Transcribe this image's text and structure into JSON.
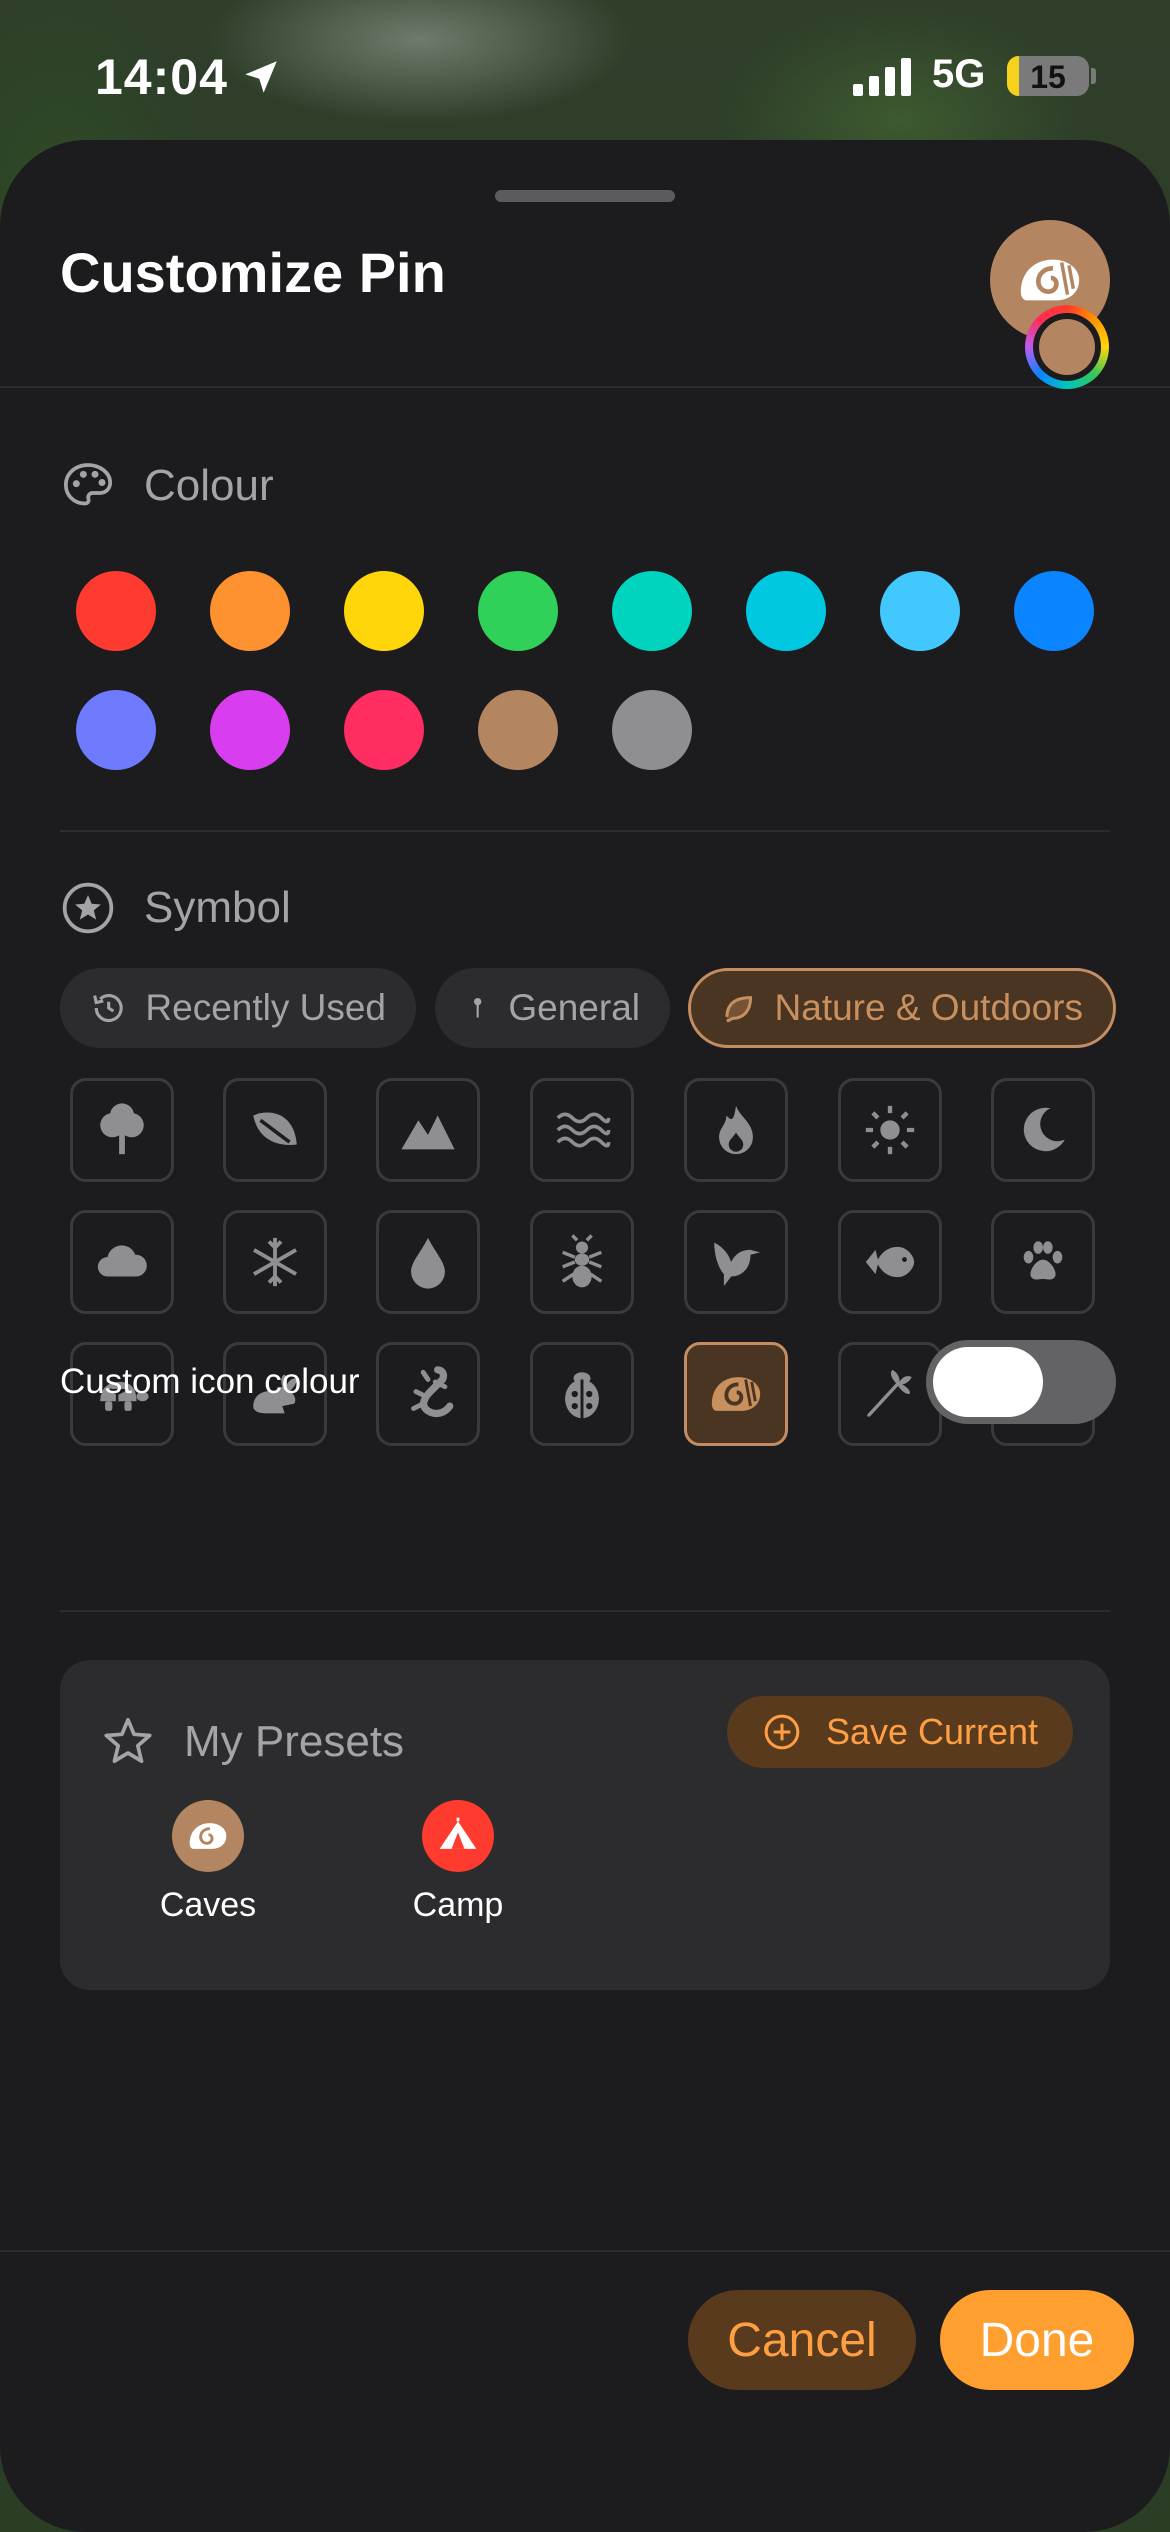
{
  "status_bar": {
    "time": "14:04",
    "network": "5G",
    "battery": "15",
    "battery_level_percent": 15,
    "icons": [
      "location-arrow-icon",
      "signal-bars-icon",
      "battery-icon"
    ]
  },
  "sheet": {
    "title": "Customize Pin",
    "selected_color": "#b38560"
  },
  "colour": {
    "label": "Colour",
    "swatches": [
      "#ff3b30",
      "#ff9230",
      "#ffd60a",
      "#30d158",
      "#00d4be",
      "#00c8e0",
      "#40c8ff",
      "#0a84ff",
      "#6e7bff",
      "#d93df0",
      "#ff2d62",
      "#b38560",
      "#8e8e93"
    ]
  },
  "symbol": {
    "label": "Symbol",
    "tabs": [
      {
        "label": "Recently Used",
        "icon": "clock-history-icon"
      },
      {
        "label": "General",
        "icon": "pin-icon"
      },
      {
        "label": "Nature & Outdoors",
        "icon": "leaf-icon",
        "active": true
      }
    ],
    "icons": [
      "tree",
      "leaf",
      "mountains",
      "water",
      "flame",
      "sun",
      "moon",
      "cloud",
      "snowflake",
      "drop",
      "ant",
      "bird",
      "fish",
      "paw",
      "tortoise",
      "rabbit",
      "lizard",
      "ladybug",
      "fossil-shell",
      "carrot",
      "tulip"
    ],
    "selected": "fossil-shell"
  },
  "custom_icon_colour": {
    "label": "Custom icon colour",
    "enabled": true
  },
  "presets": {
    "title": "My Presets",
    "save_label": "Save Current",
    "items": [
      {
        "label": "Caves",
        "color": "#b38560",
        "icon": "fossil-shell-icon"
      },
      {
        "label": "Camp",
        "color": "#ff3b30",
        "icon": "tent-icon"
      }
    ]
  },
  "actions": {
    "cancel": "Cancel",
    "done": "Done",
    "accent": "#ff9f2f"
  }
}
